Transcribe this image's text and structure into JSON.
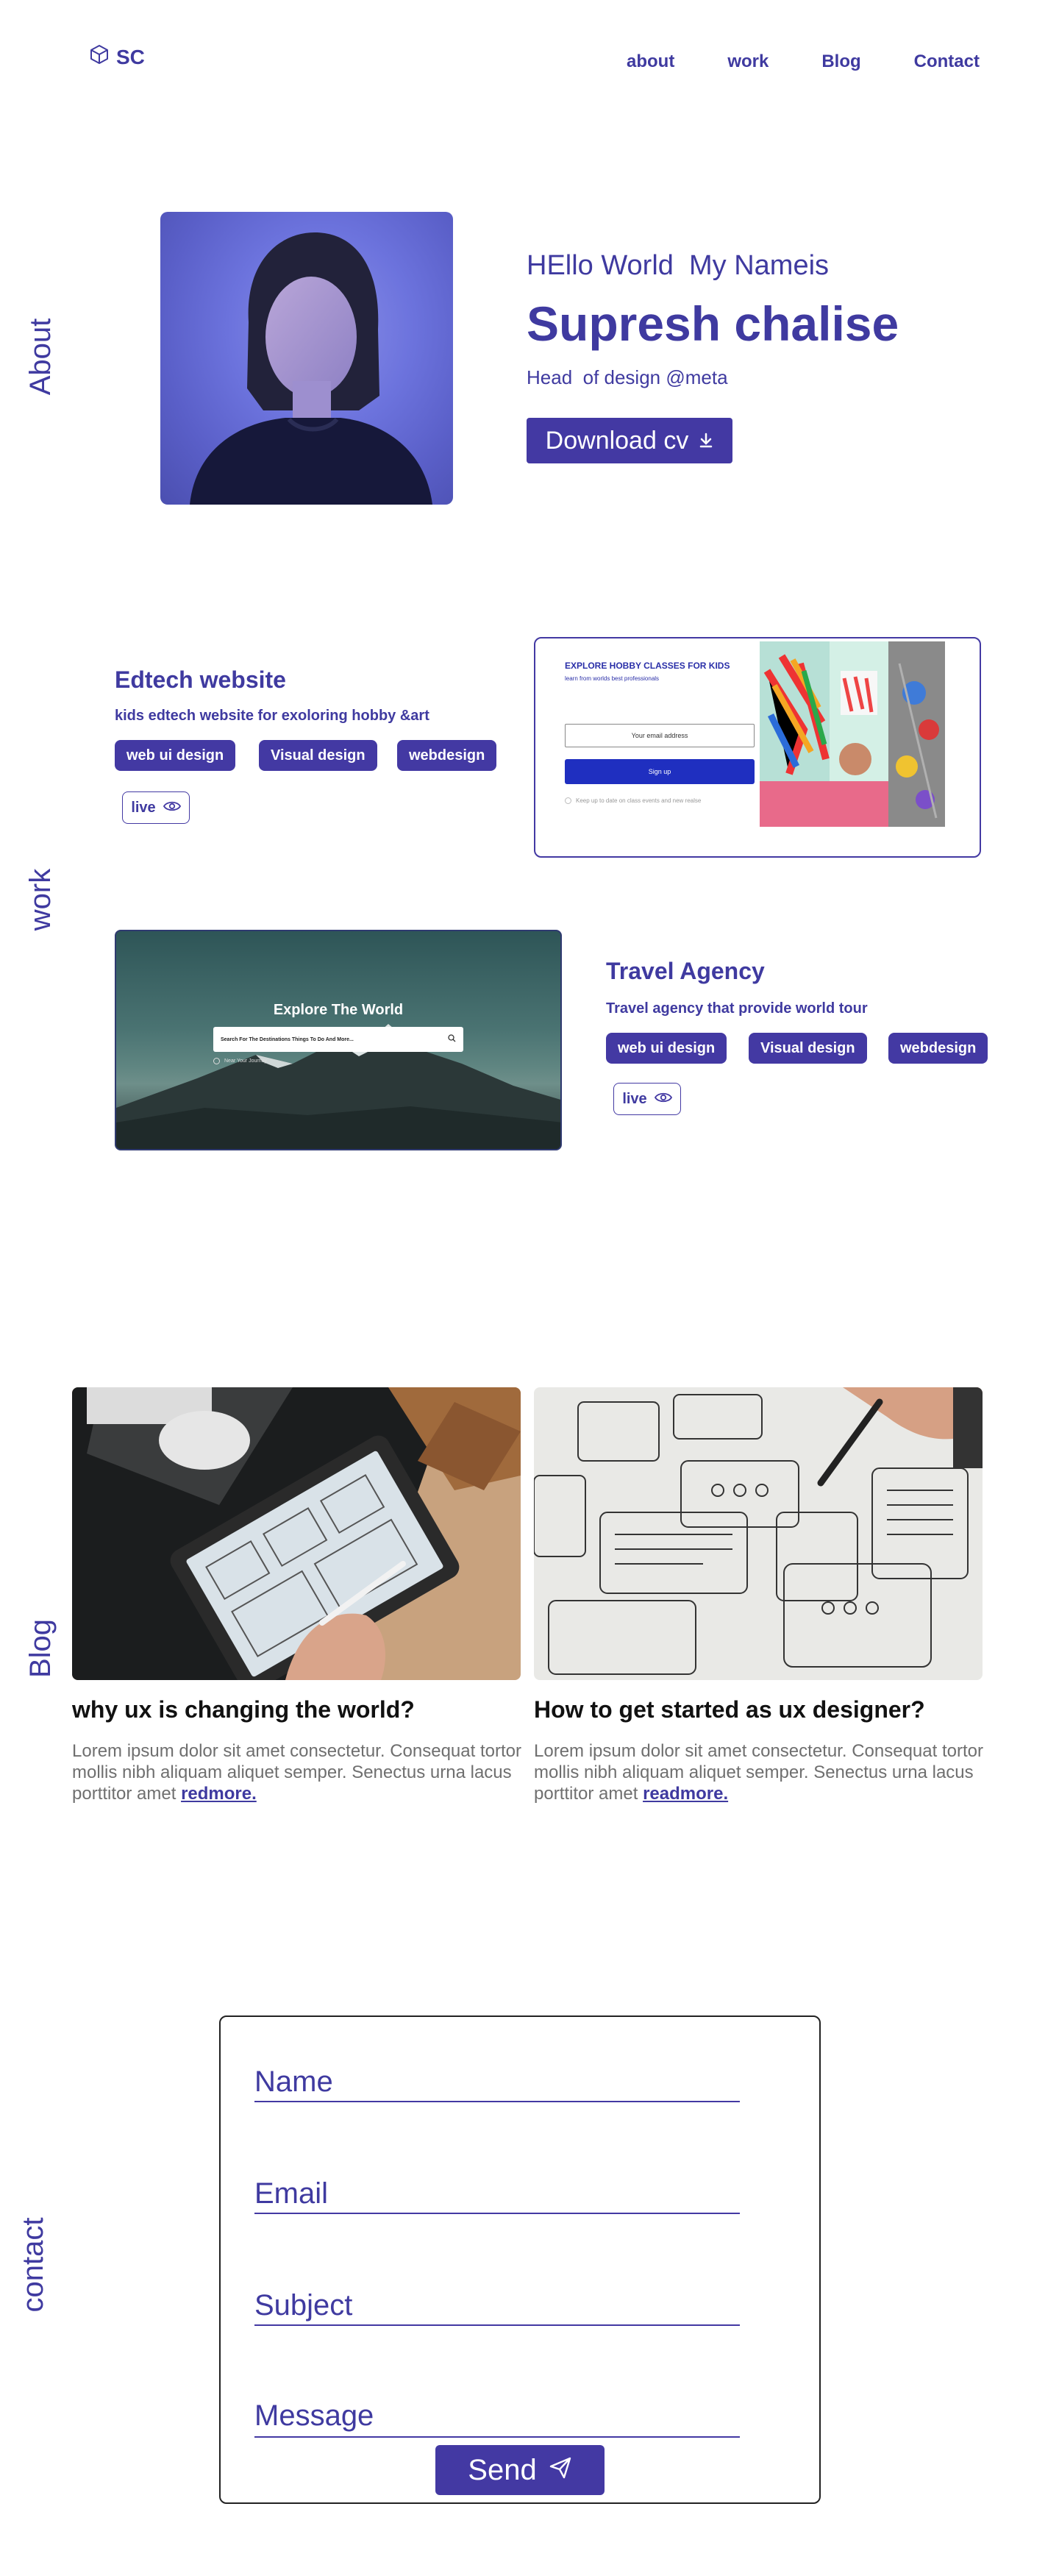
{
  "header": {
    "logo_text": "SC",
    "logo_icon": "cube-icon",
    "nav": [
      {
        "label": "about"
      },
      {
        "label": "work"
      },
      {
        "label": "Blog"
      },
      {
        "label": "Contact"
      }
    ]
  },
  "sections": {
    "about": "About",
    "work": "work",
    "blog": "Blog",
    "contact": "contact"
  },
  "hero": {
    "greeting": "HEllo World  My Nameis",
    "name": "Supresh chalise",
    "role": "Head  of design @meta",
    "cv_button": "Download cv",
    "cv_icon": "download-icon"
  },
  "projects": [
    {
      "title": "Edtech website",
      "subtitle": "kids edtech website for exoloring hobby &art",
      "tags": [
        "web ui design",
        "Visual design",
        "webdesign"
      ],
      "live_label": "live",
      "preview": {
        "heading": "EXPLORE HOBBY CLASSES FOR KIDS",
        "subheading": "learn from worlds best professionals",
        "email_placeholder": "Your email address",
        "signup": "Sign up",
        "checkbox_text": "Keep up to date on class events and new realse"
      }
    },
    {
      "title": "Travel Agency",
      "subtitle": "Travel agency that provide  world tour",
      "tags": [
        "web ui design",
        "Visual design",
        "webdesign"
      ],
      "live_label": "live",
      "preview": {
        "heading": "Explore The World",
        "search_placeholder": "Search For The Destinations Things To Do And More...",
        "checkbox_text": "Near Your Journey"
      }
    }
  ],
  "blog": [
    {
      "title": "why ux is changing the world?",
      "body": "Lorem ipsum dolor sit amet consectetur. Consequat tortor mollis nibh aliquam aliquet semper. Senectus urna lacus porttitor amet",
      "link": "redmore."
    },
    {
      "title": "How to get started as ux designer?",
      "body": "Lorem ipsum dolor sit amet consectetur. Consequat tortor mollis nibh aliquam aliquet semper. Senectus urna lacus porttitor amet",
      "link": "readmore."
    }
  ],
  "contact": {
    "name_placeholder": "Name",
    "email_placeholder": "Email",
    "subject_placeholder": "Subject",
    "message_placeholder": "Message",
    "send_label": "Send",
    "send_icon": "send-icon"
  },
  "colors": {
    "accent": "#4339a3",
    "text_dark": "#111111",
    "body_gray": "#6f6f6f"
  }
}
